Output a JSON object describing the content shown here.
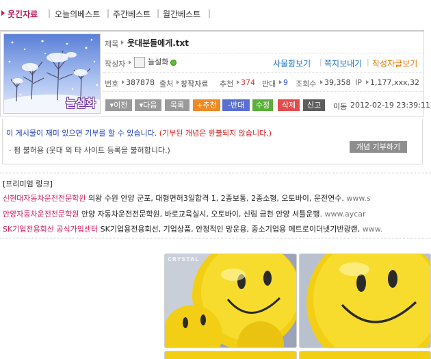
{
  "topnav": {
    "items": [
      "웃긴자료",
      "오늘의베스트",
      "주간베스트",
      "월간베스트"
    ],
    "separator": "|"
  },
  "post": {
    "thumbnail_caption": "늘설화",
    "title_label": "제목",
    "title": "웃대분들에게.txt",
    "author_label": "작성자",
    "author": "늘설화",
    "author_links": [
      "사물함보기",
      "쪽지보내기",
      "작성자글보기"
    ],
    "meta": {
      "no_label": "번호",
      "no": "387878",
      "source_label": "출처",
      "source": "창작자료",
      "recommend_label": "추천",
      "recommend": "374",
      "oppose_label": "반대",
      "oppose": "9",
      "views_label": "조회수",
      "views": "39,358",
      "ip_label": "IP",
      "ip": "1,177,xxx,32"
    },
    "buttons": [
      "▾이전",
      "▾다음",
      "목록",
      "+추천",
      "-반대",
      "수정",
      "삭제",
      "신고"
    ],
    "move_label": "이동",
    "datetime": "2012-02-19 23:39:11"
  },
  "donate": {
    "message_blue": "이 게시물이 재미 있으면 기부를 할 수 있습니다.",
    "message_red": "(기부된 개념은 환불되지 않습니다.)",
    "note": "· 펌 불허용 (웃대 외 타 사이트 등록을 불허합니다.)",
    "button": "개념 기부하기"
  },
  "premium": {
    "heading": "[프리미엄 링크]",
    "ads": [
      {
        "name": "신현대자동차운전전문학원",
        "desc": "의왕 수원 안양 군포, 대형면허3일합격 1, 2종보통, 2종소형, 오토바이, 운전연수.",
        "url": "www.s"
      },
      {
        "name": "안양자동차운전전문학원",
        "desc": "안양 자동차운전전문학원, 바로교육실시, 오토바이, 신림 금천 안양 셔틀운행.",
        "url": "www.aycar"
      },
      {
        "name": "SK기업전용회선 공식가입센터",
        "desc": "SK기업용전용회선, 기업상품, 안정적인 망운용, 중소기업용 메트로이더넷기반광랜,",
        "url": "www."
      }
    ]
  },
  "images": {
    "watermark": "CRYSTAL"
  },
  "colors": {
    "accent": "#c2185b",
    "link_blue": "#1e73be",
    "link_orange": "#e07800",
    "smiley": "#f5d21a"
  }
}
